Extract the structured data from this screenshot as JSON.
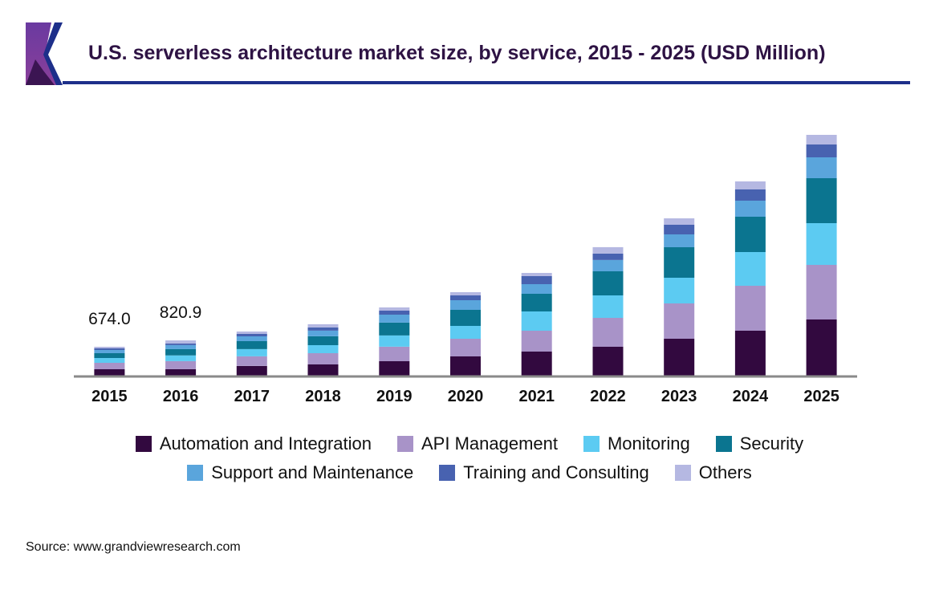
{
  "header": {
    "title": "U.S. serverless architecture market size, by service, 2015 - 2025 (USD Million)"
  },
  "source": "Source: www.grandviewresearch.com",
  "colors": {
    "title": "#2e1344",
    "rule": "#1d2f8a",
    "axis": "#8a8a8a"
  },
  "chart_data": {
    "type": "bar",
    "stacked": true,
    "title": "U.S. serverless architecture market size, by service, 2015 - 2025 (USD Million)",
    "xlabel": "",
    "ylabel": "",
    "ylim": [
      0,
      5700
    ],
    "grid": false,
    "legend_position": "bottom",
    "categories": [
      "2015",
      "2016",
      "2017",
      "2018",
      "2019",
      "2020",
      "2021",
      "2022",
      "2023",
      "2024",
      "2025"
    ],
    "annotations": [
      {
        "category": "2015",
        "text": "674.0"
      },
      {
        "category": "2016",
        "text": "820.9"
      }
    ],
    "series": [
      {
        "name": "Automation and Integration",
        "color": "#32093f",
        "values": [
          150,
          152,
          225,
          262,
          337,
          449,
          561,
          673,
          860,
          1047,
          1309
        ]
      },
      {
        "name": "API Management",
        "color": "#a893c8",
        "values": [
          150,
          187,
          225,
          262,
          337,
          411,
          486,
          673,
          823,
          1047,
          1272
        ]
      },
      {
        "name": "Monitoring",
        "color": "#5ccbf2",
        "values": [
          112,
          131,
          168,
          187,
          262,
          299,
          449,
          524,
          598,
          785,
          972
        ]
      },
      {
        "name": "Security",
        "color": "#0b7590",
        "values": [
          112,
          150,
          187,
          206,
          299,
          374,
          411,
          561,
          711,
          823,
          1047
        ]
      },
      {
        "name": "Support and Maintenance",
        "color": "#5aa5dc",
        "values": [
          75,
          93,
          112,
          131,
          187,
          224,
          224,
          262,
          299,
          374,
          486
        ]
      },
      {
        "name": "Training and Consulting",
        "color": "#4862b0",
        "values": [
          37,
          37,
          56,
          75,
          93,
          112,
          187,
          150,
          224,
          262,
          299
        ]
      },
      {
        "name": "Others",
        "color": "#b5b8e2",
        "values": [
          38,
          71,
          56,
          75,
          75,
          75,
          75,
          150,
          150,
          187,
          224
        ]
      }
    ]
  }
}
